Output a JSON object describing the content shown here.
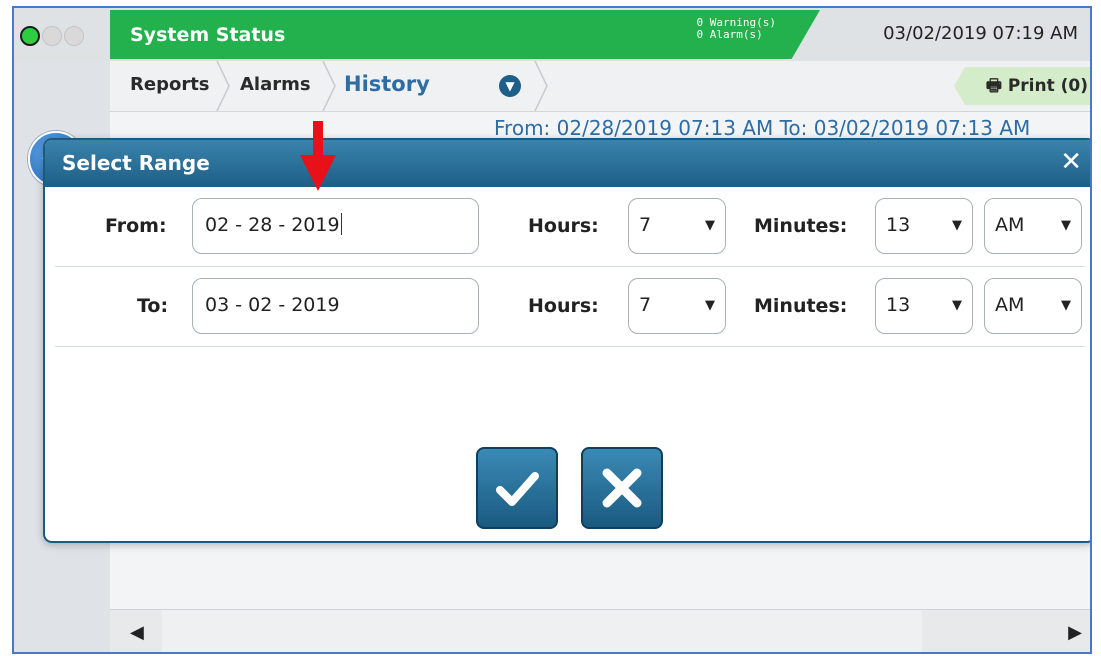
{
  "status_bar": {
    "title": "System Status",
    "warnings": "0 Warning(s)",
    "alarms": "0 Alarm(s)",
    "datetime": "03/02/2019 07:19 AM",
    "accent_color": "#22b14c"
  },
  "nav": {
    "items": [
      "Reports",
      "Alarms",
      "History"
    ],
    "active": "History",
    "print_label": "Print (0)"
  },
  "background_range": "From: 02/28/2019 07:13 AM   To: 03/02/2019 07:13 AM",
  "modal": {
    "title": "Select Range",
    "from": {
      "label": "From:",
      "date": "02 - 28 - 2019",
      "hours_label": "Hours:",
      "hours": "7",
      "minutes_label": "Minutes:",
      "minutes": "13",
      "ampm": "AM"
    },
    "to": {
      "label": "To:",
      "date": "03 - 02 - 2019",
      "hours_label": "Hours:",
      "hours": "7",
      "minutes_label": "Minutes:",
      "minutes": "13",
      "ampm": "AM"
    },
    "confirm_icon": "check-icon",
    "cancel_icon": "x-icon"
  },
  "icons": {
    "home": "home-icon",
    "print": "printer-icon",
    "close": "close-icon",
    "dropdown": "chevron-down-icon",
    "annotation": "red-arrow-icon"
  }
}
